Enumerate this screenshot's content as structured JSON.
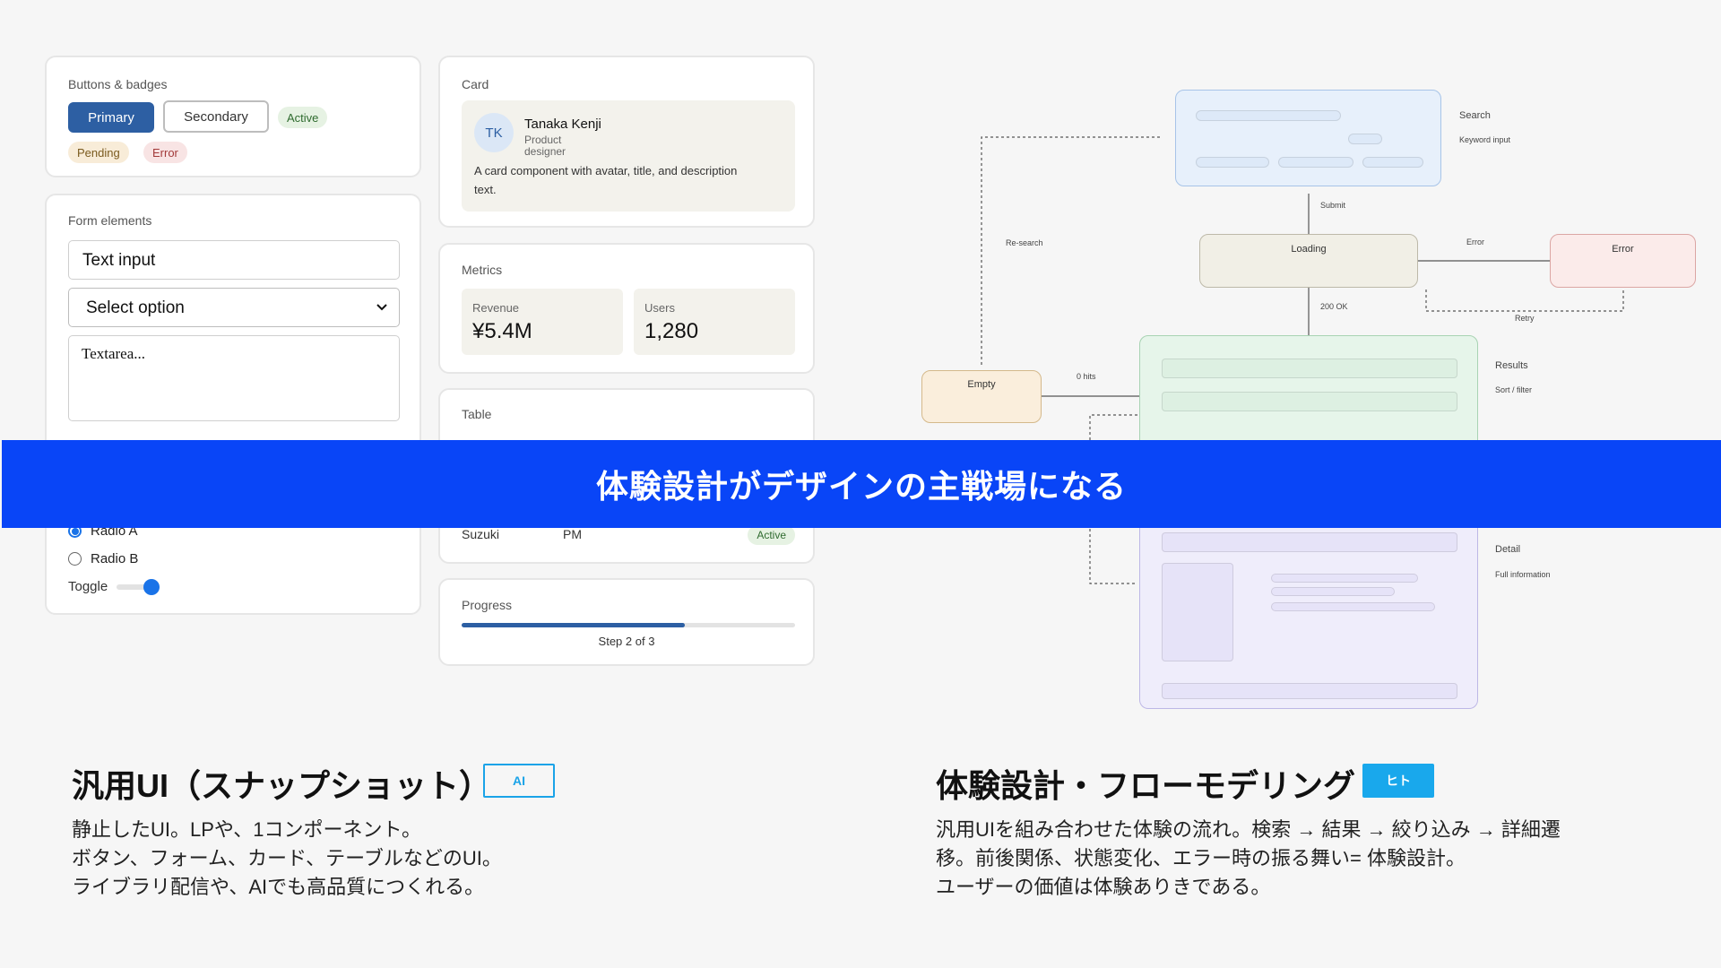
{
  "buttons_panel": {
    "title": "Buttons & badges",
    "primary": "Primary",
    "secondary": "Secondary",
    "badges": {
      "active": "Active",
      "pending": "Pending",
      "error": "Error"
    }
  },
  "form_panel": {
    "title": "Form elements",
    "text_input_value": "Text input",
    "select_value": "Select option",
    "textarea_placeholder": "Textarea...",
    "radio_a": "Radio A",
    "radio_b": "Radio B",
    "radio_selected": "Radio A",
    "toggle_label": "Toggle",
    "toggle_on": true
  },
  "card_panel": {
    "title": "Card",
    "avatar_initials": "TK",
    "name": "Tanaka Kenji",
    "role": "Product designer",
    "description": "A card component with avatar, title, and description text."
  },
  "metrics_panel": {
    "title": "Metrics",
    "items": [
      {
        "label": "Revenue",
        "value": "¥5.4M"
      },
      {
        "label": "Users",
        "value": "1,280"
      }
    ]
  },
  "table_panel": {
    "title": "Table",
    "visible_row": {
      "name": "Suzuki",
      "role": "PM",
      "status": "Active"
    }
  },
  "progress_panel": {
    "title": "Progress",
    "progress": 0.67,
    "step_text": "Step 2 of 3"
  },
  "flow": {
    "nodes": {
      "search": {
        "title": "Search",
        "subtitle": "Keyword input"
      },
      "loading": "Loading",
      "error": "Error",
      "empty": "Empty",
      "results": {
        "title": "Results",
        "subtitle": "Sort / filter"
      },
      "detail": {
        "title": "Detail",
        "subtitle": "Full information"
      }
    },
    "edges": {
      "submit": "Submit",
      "ok": "200 OK",
      "error": "Error",
      "retry": "Retry",
      "research": "Re-search",
      "zero_hits": "0 hits"
    }
  },
  "banner": "体験設計がデザインの主戦場になる",
  "left_section": {
    "heading": "汎用UI（スナップショット）",
    "tag": "AI",
    "description": "静止したUI。LPや、1コンポーネント。\nボタン、フォーム、カード、テーブルなどのUI。\nライブラリ配信や、AIでも高品質につくれる。"
  },
  "right_section": {
    "heading": "体験設計・フローモデリング",
    "tag": "ヒト",
    "description": "汎用UIを組み合わせた体験の流れ。検索 → 結果 → 絞り込み → 詳細遷\n移。前後関係、状態変化、エラー時の振る舞い= 体験設計。\nユーザーの価値は体験ありきである。"
  },
  "colors": {
    "banner": "#0945f7",
    "primary": "#2d5fa3",
    "ai_tag": "#1aa3e8",
    "human_tag": "#19a8ec",
    "active_badge": "#e6f2e3",
    "pending_badge": "#f8ecd8",
    "error_badge": "#f8e4e4"
  }
}
